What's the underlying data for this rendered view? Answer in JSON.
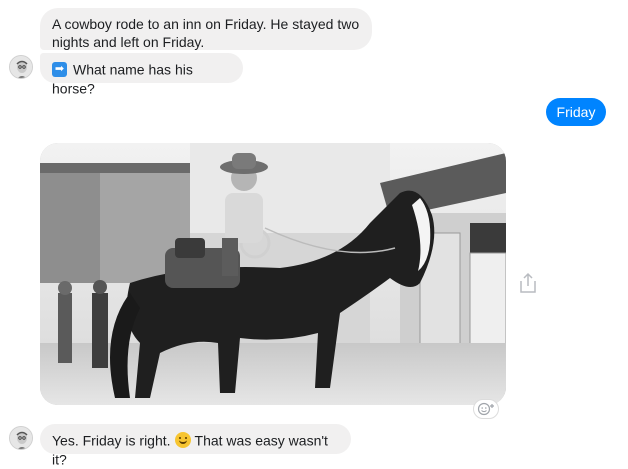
{
  "messages": {
    "first_text": "A cowboy rode to an inn on Friday. He stayed two nights and left on Friday.",
    "question_text": "What name has his horse?",
    "question_emoji": "right-arrow-emoji",
    "sent_reply": "Friday",
    "answer_text_before": "Yes. Friday is right.",
    "answer_emoji": "slightly-smiling-face-emoji",
    "answer_text_after": "That was easy wasn't it?"
  },
  "photo": {
    "subject": "child-on-horse-photo"
  },
  "colors": {
    "sent_bubble": "#0084ff",
    "received_bubble": "#f1f0f0"
  },
  "icons": {
    "share": "share-icon",
    "react": "add-reaction-icon",
    "avatar": "bot-avatar"
  }
}
